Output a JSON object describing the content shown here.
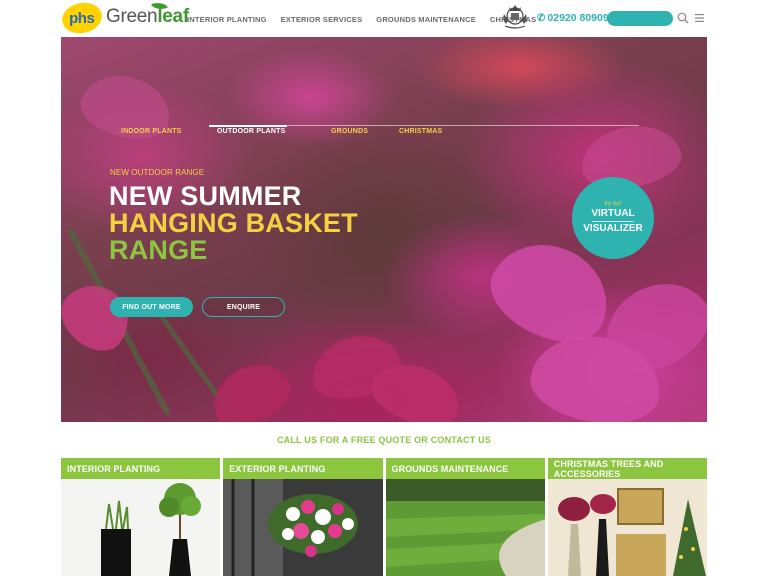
{
  "header": {
    "logo_phs": "phs",
    "logo_greenleaf_a": "Green",
    "logo_greenleaf_b": "leaf",
    "nav": [
      {
        "label": "INTERIOR PLANTING"
      },
      {
        "label": "EXTERIOR SERVICES"
      },
      {
        "label": "GROUNDS MAINTENANCE"
      },
      {
        "label": "CHRISTMAS"
      }
    ],
    "phone": "02920 809098",
    "icons": {
      "search": "search-icon",
      "menu": "hamburger-menu-icon",
      "phone": "phone-icon",
      "crest": "royal-warrant-crest-icon"
    }
  },
  "hero": {
    "tabs": [
      {
        "label": "INDOOR PLANTS",
        "active": false
      },
      {
        "label": "OUTDOOR PLANTS",
        "active": true
      },
      {
        "label": "GROUNDS",
        "active": false
      },
      {
        "label": "CHRISTMAS",
        "active": false
      }
    ],
    "kicker": "NEW OUTDOOR RANGE",
    "title_line1": "NEW SUMMER",
    "title_line2": "HANGING BASKET",
    "title_line3": "RANGE",
    "btn_find": "FIND OUT MORE",
    "btn_enquire": "ENQUIRE",
    "visualizer": {
      "try": "try our",
      "line1": "VIRTUAL",
      "line2": "VISUALIZER"
    }
  },
  "callus": "CALL US FOR A FREE QUOTE OR CONTACT US",
  "cards": [
    {
      "title": "INTERIOR PLANTING"
    },
    {
      "title": "EXTERIOR PLANTING"
    },
    {
      "title": "GROUNDS MAINTENANCE"
    },
    {
      "title": "CHRISTMAS TREES AND ACCESSORIES"
    }
  ],
  "colors": {
    "teal": "#2fb3b0",
    "green": "#8cc63f",
    "yellow": "#f5d142",
    "phs_yellow": "#ffd200"
  }
}
